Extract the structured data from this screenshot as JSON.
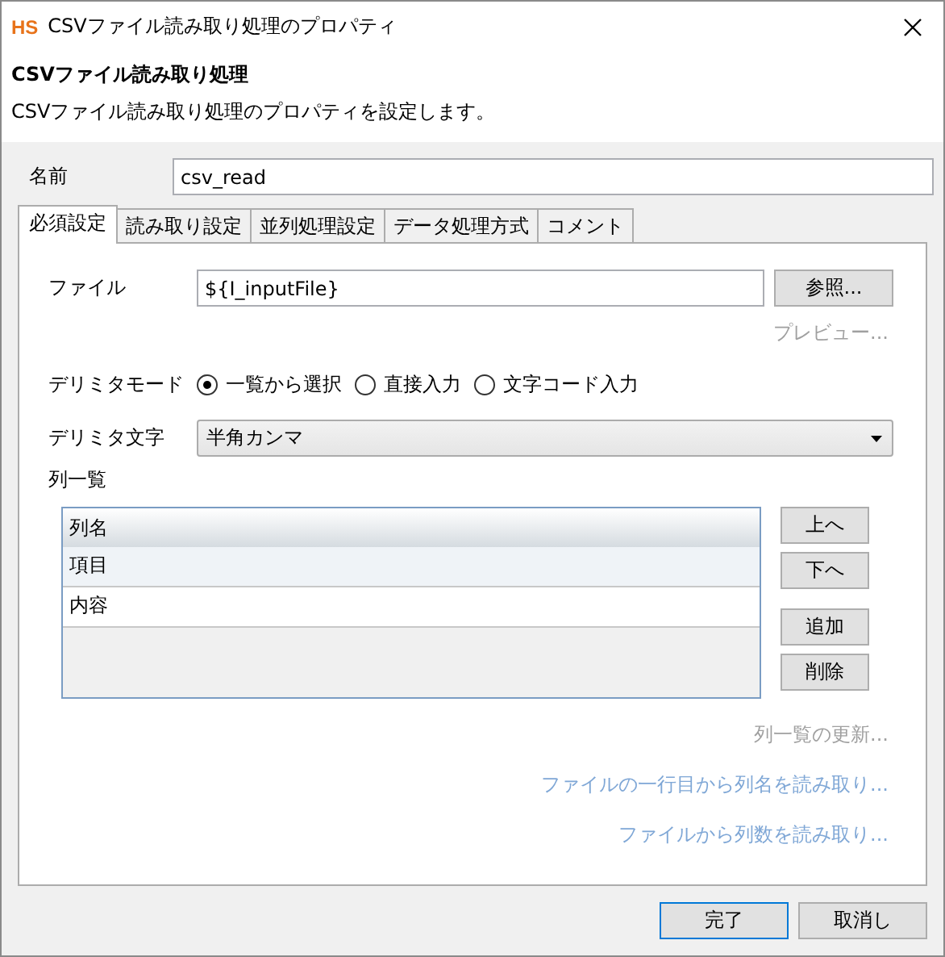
{
  "window": {
    "logo": "HS",
    "title": "CSVファイル読み取り処理のプロパティ"
  },
  "header": {
    "title": "CSVファイル読み取り処理",
    "description": "CSVファイル読み取り処理のプロパティを設定します。"
  },
  "name_field": {
    "label": "名前",
    "value": "csv_read"
  },
  "tabs": [
    {
      "label": "必須設定",
      "selected": true
    },
    {
      "label": "読み取り設定",
      "selected": false
    },
    {
      "label": "並列処理設定",
      "selected": false
    },
    {
      "label": "データ処理方式",
      "selected": false
    },
    {
      "label": "コメント",
      "selected": false
    }
  ],
  "file": {
    "label": "ファイル",
    "value": "${I_inputFile}",
    "button": "参照...",
    "preview_link": {
      "label": "プレビュー...",
      "disabled": true
    }
  },
  "delimiter_mode": {
    "label": "デリミタモード",
    "options": [
      {
        "label": "一覧から選択",
        "selected": true
      },
      {
        "label": "直接入力",
        "selected": false
      },
      {
        "label": "文字コード入力",
        "selected": false
      }
    ]
  },
  "delimiter_char": {
    "label": "デリミタ文字",
    "value": "半角カンマ"
  },
  "column_list": {
    "label": "列一覧",
    "header": "列名",
    "rows": [
      {
        "name": "項目",
        "selected": true
      },
      {
        "name": "内容",
        "selected": false
      }
    ],
    "buttons": [
      "上へ",
      "下へ",
      "追加",
      "削除"
    ]
  },
  "links": [
    {
      "label": "列一覧の更新...",
      "disabled": true
    },
    {
      "label": "ファイルの一行目から列名を読み取り...",
      "disabled": false
    },
    {
      "label": "ファイルから列数を読み取り...",
      "disabled": false
    }
  ],
  "footer_buttons": [
    {
      "label": "完了",
      "default": true
    },
    {
      "label": "取消し",
      "default": false
    }
  ]
}
